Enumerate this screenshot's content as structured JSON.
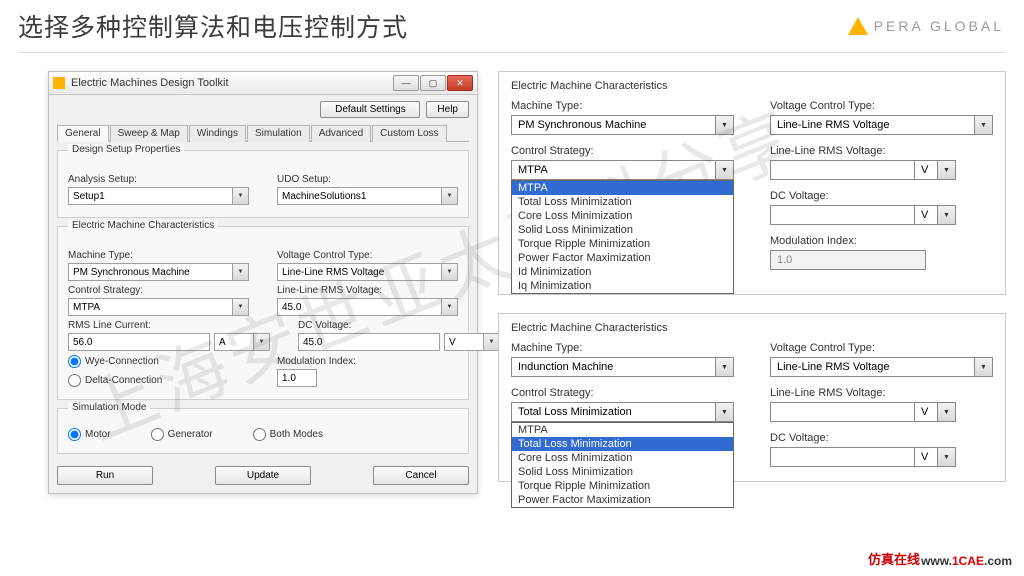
{
  "header": {
    "title": "选择多种控制算法和电压控制方式",
    "logo_text": "PERA GLOBAL"
  },
  "watermark": "上海安世亚太资料分享",
  "dialog": {
    "title": "Electric Machines Design Toolkit",
    "default_settings": "Default Settings",
    "help": "Help",
    "tabs": [
      "General",
      "Sweep & Map",
      "Windings",
      "Simulation",
      "Advanced",
      "Custom Loss"
    ],
    "g1": {
      "title": "Design Setup Properties",
      "analysis_lbl": "Analysis Setup:",
      "analysis_val": "Setup1",
      "udo_lbl": "UDO Setup:",
      "udo_val": "MachineSolutions1"
    },
    "g2": {
      "title": "Electric Machine Characteristics",
      "mtype_lbl": "Machine Type:",
      "mtype_val": "PM Synchronous Machine",
      "vctrl_lbl": "Voltage Control Type:",
      "vctrl_val": "Line-Line RMS Voltage",
      "cstrat_lbl": "Control Strategy:",
      "cstrat_val": "MTPA",
      "llrms_lbl": "Line-Line RMS Voltage:",
      "llrms_val": "45.0",
      "rmscur_lbl": "RMS Line Current:",
      "rmscur_val": "56.0",
      "rmscur_unit": "A",
      "dc_lbl": "DC Voltage:",
      "dc_val": "45.0",
      "dc_unit": "V",
      "wye": "Wye-Connection",
      "delta": "Delta-Connection",
      "mod_lbl": "Modulation Index:",
      "mod_val": "1.0"
    },
    "g3": {
      "title": "Simulation Mode",
      "motor": "Motor",
      "generator": "Generator",
      "both": "Both Modes"
    },
    "run": "Run",
    "update": "Update",
    "cancel": "Cancel"
  },
  "panel1": {
    "title": "Electric Machine Characteristics",
    "mtype_lbl": "Machine Type:",
    "mtype_val": "PM Synchronous Machine",
    "vctrl_lbl": "Voltage Control Type:",
    "vctrl_val": "Line-Line RMS Voltage",
    "cstrat_lbl": "Control Strategy:",
    "cstrat_val": "MTPA",
    "cstrat_opts": [
      "MTPA",
      "Total Loss Minimization",
      "Core Loss Minimization",
      "Solid Loss Minimization",
      "Torque Ripple Minimization",
      "Power Factor Maximization",
      "Id Minimization",
      "Iq Minimization"
    ],
    "llrms_lbl": "Line-Line RMS Voltage:",
    "v_unit": "V",
    "dc_lbl": "DC Voltage:",
    "mod_lbl": "Modulation Index:",
    "mod_val": "1.0"
  },
  "panel2": {
    "title": "Electric Machine Characteristics",
    "mtype_lbl": "Machine Type:",
    "mtype_val": "Indunction Machine",
    "vctrl_lbl": "Voltage Control Type:",
    "vctrl_val": "Line-Line RMS Voltage",
    "cstrat_lbl": "Control Strategy:",
    "cstrat_val": "Total Loss Minimization",
    "cstrat_opts": [
      "MTPA",
      "Total Loss Minimization",
      "Core Loss Minimization",
      "Solid Loss Minimization",
      "Torque Ripple Minimization",
      "Power Factor Maximization"
    ],
    "llrms_lbl": "Line-Line RMS Voltage:",
    "v_unit": "V",
    "dc_lbl": "DC Voltage:"
  },
  "footer": {
    "brand": "仿真在线",
    "site_pre": "www.",
    "site_mid": "1CAE",
    "site_post": ".com"
  }
}
